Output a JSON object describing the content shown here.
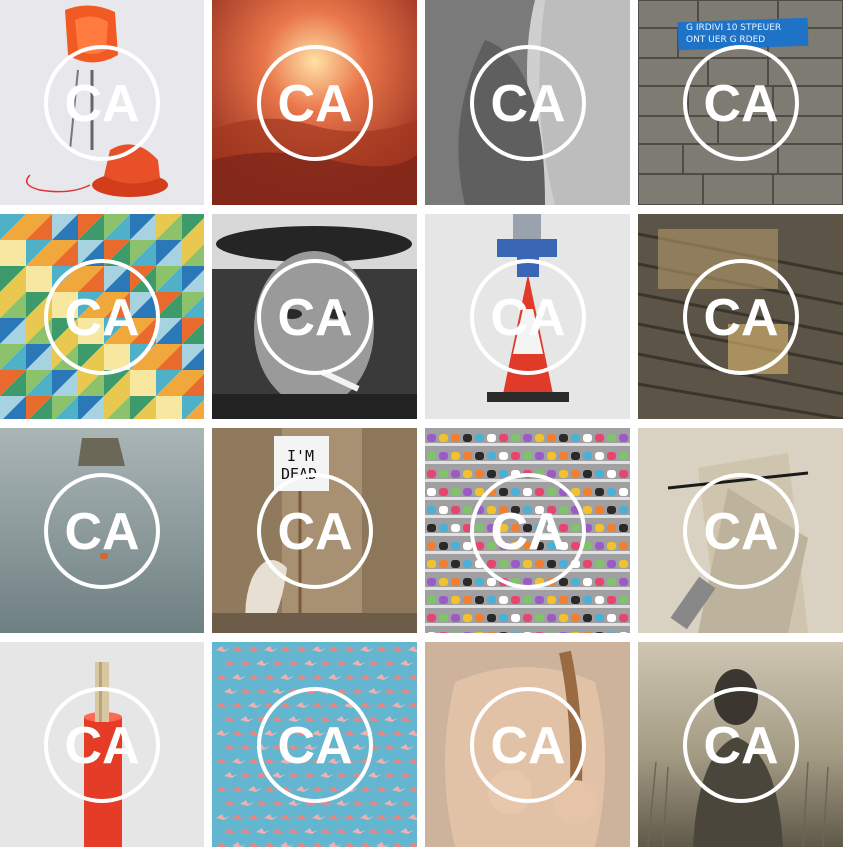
{
  "tiles": [
    {
      "id": "t1",
      "subject": "orange life vest on hovercraft",
      "palette": {
        "bg": "#e9e9ec",
        "accent": "#f15a22"
      }
    },
    {
      "id": "t2",
      "subject": "sunset clouds",
      "palette": {
        "bg": "#c4482a",
        "accent": "#ffd28b"
      }
    },
    {
      "id": "t3",
      "subject": "black and white kiss",
      "palette": {
        "bg": "#7c7c7c",
        "accent": "#d9d9d9"
      }
    },
    {
      "id": "t4",
      "subject": "stone wall with street sign",
      "palette": {
        "bg": "#6a6760",
        "accent": "#1f73c7"
      }
    },
    {
      "id": "t5",
      "subject": "colorful triangle mosaic",
      "palette": {
        "bg": "#e9c84f",
        "accent": "#2b78b8"
      }
    },
    {
      "id": "t6",
      "subject": "man with hat and cigarette",
      "palette": {
        "bg": "#6f6f6f",
        "accent": "#1d1d1d"
      }
    },
    {
      "id": "t7",
      "subject": "traffic cone with bottle",
      "palette": {
        "bg": "#e6e6e6",
        "accent": "#e03a28"
      }
    },
    {
      "id": "t8",
      "subject": "letterpress type",
      "palette": {
        "bg": "#5f584c",
        "accent": "#caa96a"
      }
    },
    {
      "id": "t9",
      "subject": "water and pier",
      "palette": {
        "bg": "#8c9ea1",
        "accent": "#6b6b5a"
      }
    },
    {
      "id": "t10",
      "subject": "dog holding sign",
      "palette": {
        "bg": "#a58e6f",
        "accent": "#f2f2f2"
      }
    },
    {
      "id": "t11",
      "subject": "pill shelves",
      "palette": {
        "bg": "#9d9d9f",
        "accent": "#e7456d"
      }
    },
    {
      "id": "t12",
      "subject": "abstract suprematist painting",
      "palette": {
        "bg": "#d7cfbf",
        "accent": "#7a6e5a"
      }
    },
    {
      "id": "t13",
      "subject": "red cylinder with clothespin",
      "palette": {
        "bg": "#e5e5e6",
        "accent": "#e43c26"
      }
    },
    {
      "id": "t14",
      "subject": "flamingos in flight",
      "palette": {
        "bg": "#63b6cf",
        "accent": "#e38a86"
      }
    },
    {
      "id": "t15",
      "subject": "figure with braid",
      "palette": {
        "bg": "#d4b8a1",
        "accent": "#b88763"
      }
    },
    {
      "id": "t16",
      "subject": "sepia portrait in field",
      "palette": {
        "bg": "#a8a08a",
        "accent": "#3b382f"
      }
    }
  ],
  "texts": {
    "t4_sign_line1": "G IRDIVI  10 STPEUER",
    "t4_sign_line2": "ONT   UER G RDED",
    "t10_sign_line1": "I'M",
    "t10_sign_line2": "DEAD"
  },
  "logo": {
    "text": "CA",
    "color": "#ffffff"
  }
}
